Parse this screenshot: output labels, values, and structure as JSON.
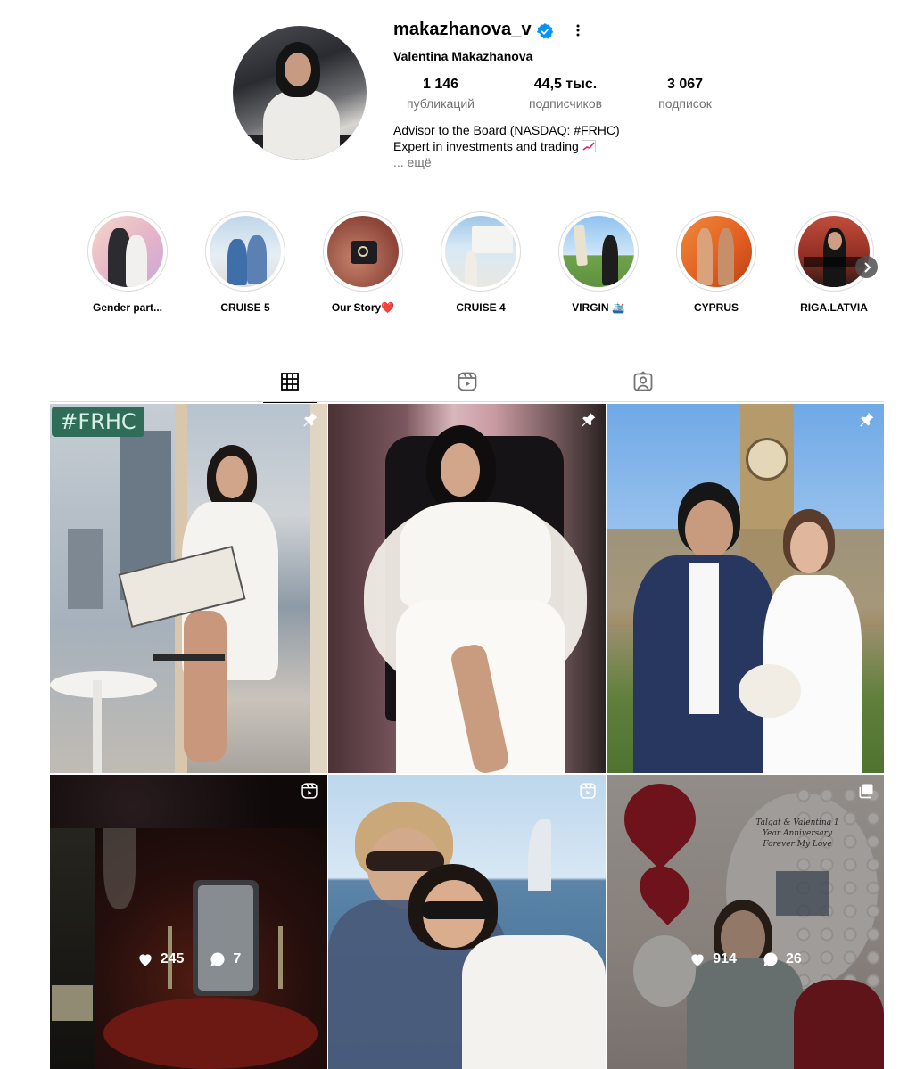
{
  "profile": {
    "username": "makazhanova_v",
    "full_name": "Valentina Makazhanova",
    "verified": true,
    "stats": {
      "posts_count": "1 146",
      "posts_label": "публикаций",
      "followers_count": "44,5 тыс.",
      "followers_label": "подписчиков",
      "following_count": "3 067",
      "following_label": "подписок"
    },
    "bio_line1": "Advisor to the Board (NASDAQ: #FRHC)",
    "bio_line2": "Expert in investments and trading",
    "bio_more": "... ещё"
  },
  "highlights": [
    {
      "label": "Gender part..."
    },
    {
      "label": "CRUISE 5"
    },
    {
      "label": "Our Story❤️"
    },
    {
      "label": "CRUISE 4"
    },
    {
      "label": "VIRGIN 🛳️"
    },
    {
      "label": "CYPRUS"
    },
    {
      "label": "RIGA.LATVIA"
    }
  ],
  "tabs": [
    {
      "name": "posts",
      "icon": "grid-icon",
      "active": true
    },
    {
      "name": "reels",
      "icon": "reels-icon",
      "active": false
    },
    {
      "name": "tagged",
      "icon": "tagged-icon",
      "active": false
    }
  ],
  "posts": [
    {
      "type": "pinned",
      "icon": "pin-icon",
      "caption_text": "#FRHC"
    },
    {
      "type": "pinned",
      "icon": "pin-icon"
    },
    {
      "type": "pinned",
      "icon": "pin-icon"
    },
    {
      "type": "reel",
      "icon": "reels-icon",
      "likes": "245",
      "comments": "7",
      "hover": true
    },
    {
      "type": "reel",
      "icon": "reels-icon"
    },
    {
      "type": "carousel",
      "icon": "carousel-icon",
      "likes": "914",
      "comments": "26",
      "hover": true,
      "sign_text": "Talgat & Valentina 1 Year Anniversary Forever My Love"
    }
  ],
  "colors": {
    "verified": "#0095f6",
    "secondary_text": "#737373",
    "border": "#dbdbdb"
  }
}
